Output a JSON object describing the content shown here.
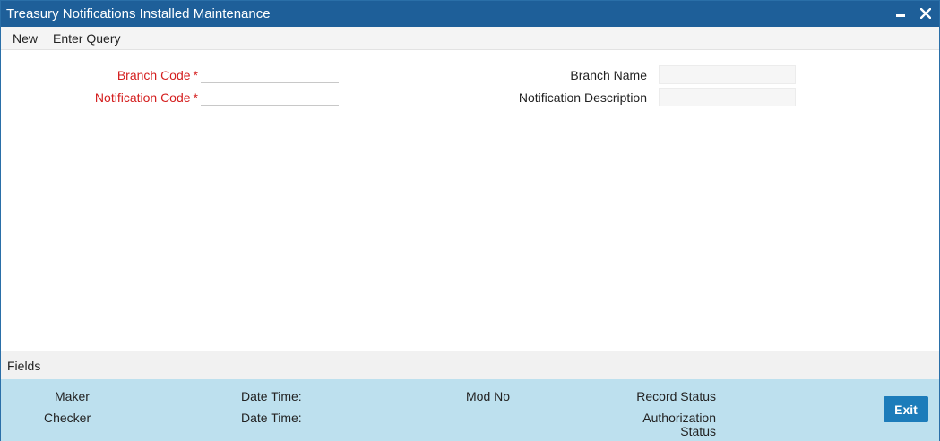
{
  "window": {
    "title": "Treasury Notifications Installed Maintenance",
    "minimize_icon": "minimize-icon",
    "close_icon": "close-icon"
  },
  "menu": {
    "new_label": "New",
    "enter_query_label": "Enter Query"
  },
  "form": {
    "branch_code": {
      "label": "Branch Code",
      "required_mark": "*",
      "value": ""
    },
    "notification_code": {
      "label": "Notification Code",
      "required_mark": "*",
      "value": ""
    },
    "branch_name": {
      "label": "Branch Name",
      "value": ""
    },
    "notification_description": {
      "label": "Notification Description",
      "value": ""
    }
  },
  "fields_bar": {
    "label": "Fields"
  },
  "audit": {
    "maker_label": "Maker",
    "checker_label": "Checker",
    "maker_datetime_label": "Date Time:",
    "checker_datetime_label": "Date Time:",
    "mod_no_label": "Mod No",
    "record_status_label": "Record Status",
    "authorization_label": "Authorization",
    "status_label": "Status",
    "exit_label": "Exit"
  },
  "colors": {
    "titlebar": "#1e5f99",
    "required_label": "#d41e1e",
    "footer": "#bde0ee",
    "exit_button": "#1c7cba"
  }
}
